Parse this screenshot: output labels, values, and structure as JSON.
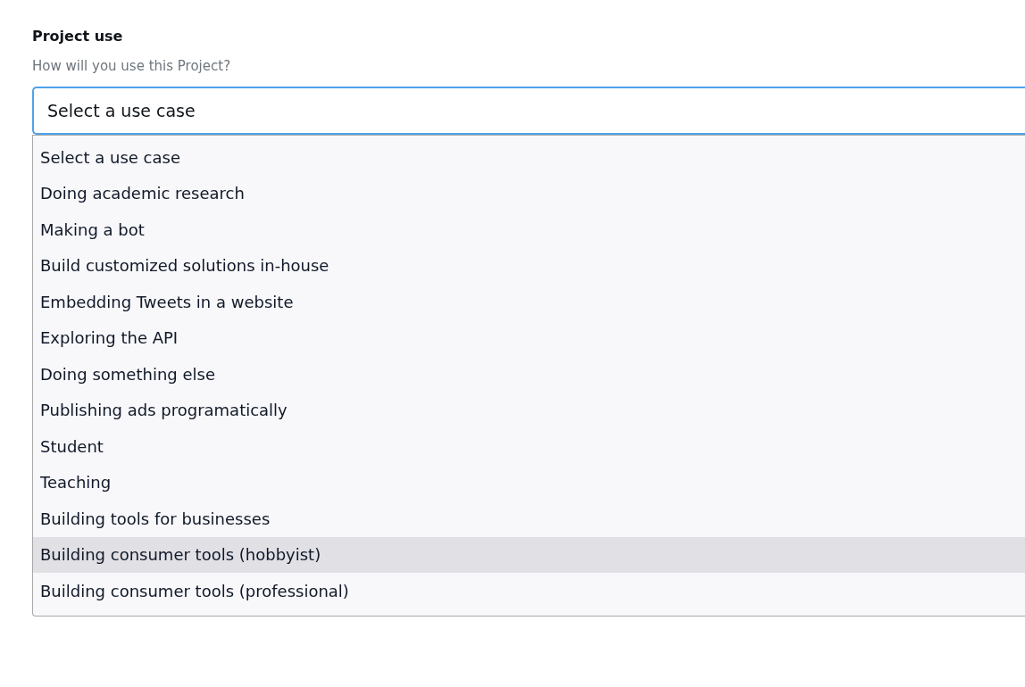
{
  "field": {
    "label": "Project use",
    "hint": "How will you use this Project?",
    "value": "Select a use case",
    "expanded": true
  },
  "options": [
    {
      "label": "Select a use case",
      "selected": false
    },
    {
      "label": "Doing academic research",
      "selected": false
    },
    {
      "label": "Making a bot",
      "selected": false
    },
    {
      "label": "Build customized solutions in-house",
      "selected": false
    },
    {
      "label": "Embedding Tweets in a website",
      "selected": false
    },
    {
      "label": "Exploring the API",
      "selected": false
    },
    {
      "label": "Doing something else",
      "selected": false
    },
    {
      "label": "Publishing ads programatically",
      "selected": false
    },
    {
      "label": "Student",
      "selected": false
    },
    {
      "label": "Teaching",
      "selected": false
    },
    {
      "label": "Building tools for businesses",
      "selected": false
    },
    {
      "label": "Building consumer tools (hobbyist)",
      "selected": true
    },
    {
      "label": "Building consumer tools (professional)",
      "selected": false
    }
  ]
}
